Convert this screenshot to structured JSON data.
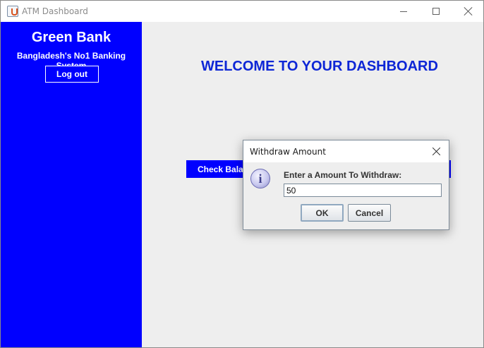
{
  "window": {
    "title": "ATM Dashboard"
  },
  "sidebar": {
    "bank_name": "Green Bank",
    "tagline": "Bangladesh's No1 Banking System",
    "logout_label": "Log out"
  },
  "main": {
    "welcome": "WELCOME TO YOUR DASHBOARD",
    "check_balance_label": "Check Bala"
  },
  "dialog": {
    "title": "Withdraw Amount",
    "icon": "info-icon",
    "icon_glyph": "i",
    "prompt": "Enter a Amount To Withdraw:",
    "input_value": "50",
    "ok_label": "OK",
    "cancel_label": "Cancel"
  },
  "colors": {
    "sidebar_bg": "#0000ff",
    "welcome_text": "#0d26d6",
    "panel_bg": "#eeeeee"
  }
}
